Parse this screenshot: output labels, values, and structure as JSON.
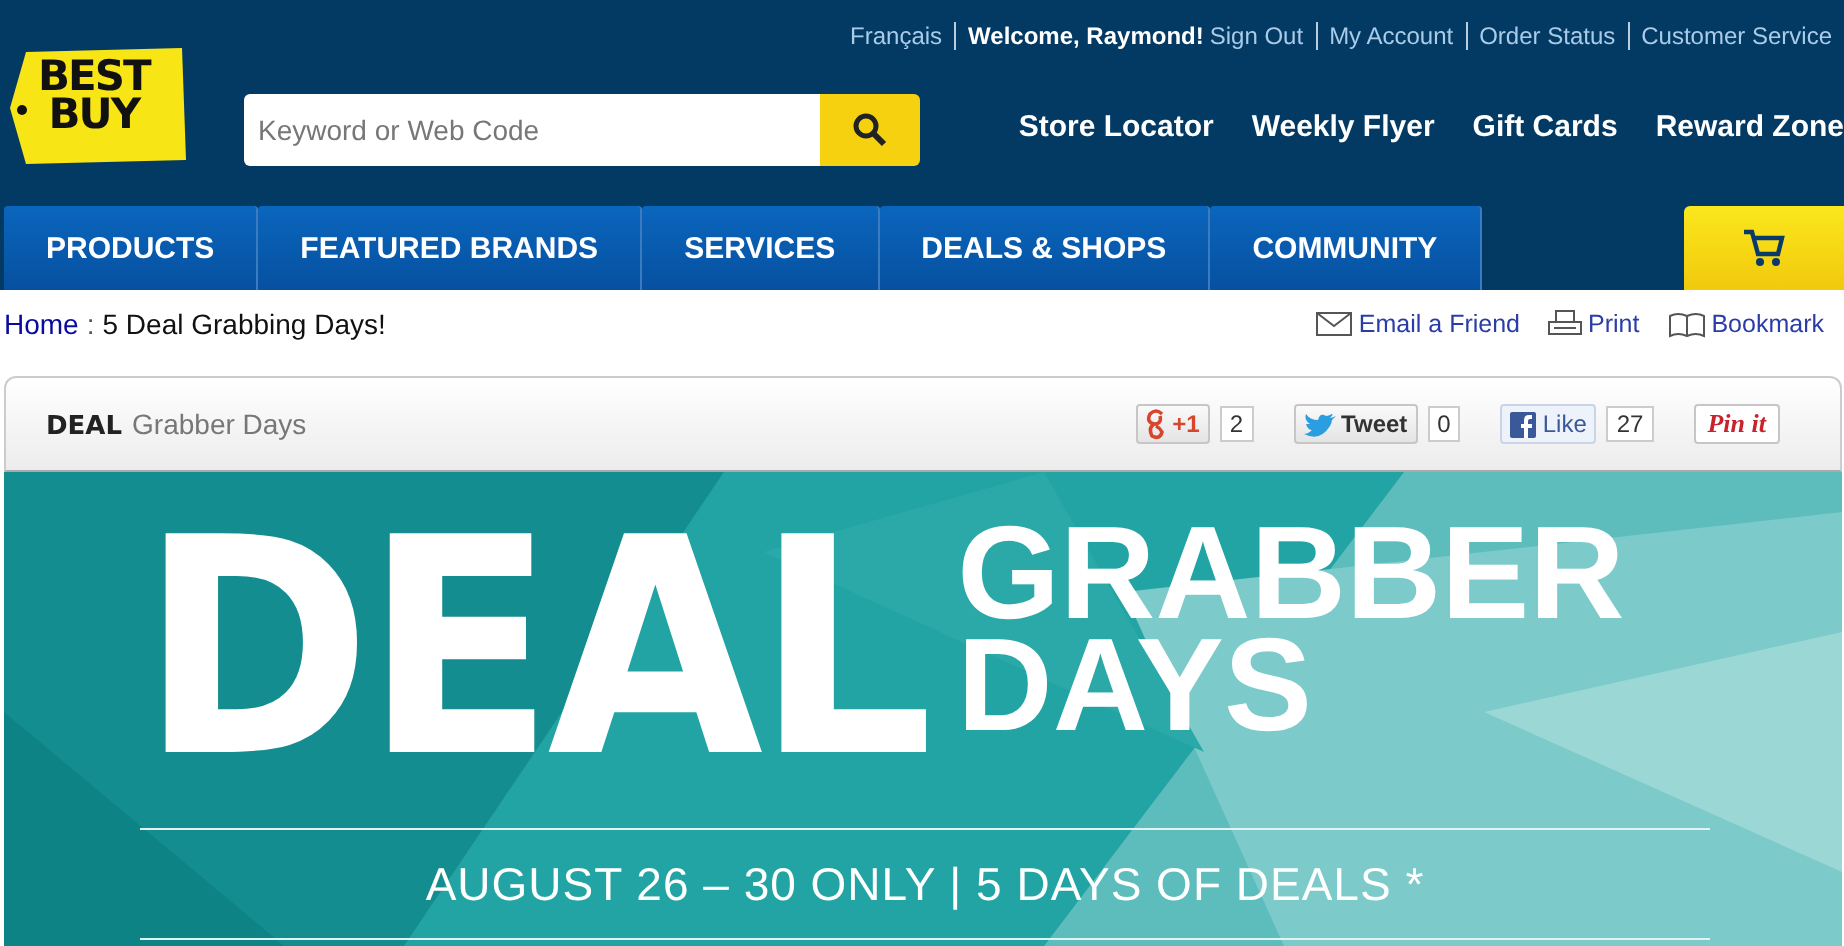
{
  "logo": {
    "lines": [
      "BEST",
      "BUY"
    ]
  },
  "utility_links": [
    {
      "label": "Français",
      "kind": "link"
    },
    {
      "label": "Welcome, Raymond!",
      "kind": "text"
    },
    {
      "label": "Sign Out",
      "kind": "link"
    },
    {
      "label": "My Account",
      "kind": "link"
    },
    {
      "label": "Order Status",
      "kind": "link"
    },
    {
      "label": "Customer Service",
      "kind": "link"
    }
  ],
  "search": {
    "placeholder": "Keyword or Web Code"
  },
  "main_links": [
    "Store Locator",
    "Weekly Flyer",
    "Gift Cards",
    "Reward Zone"
  ],
  "nav": [
    "PRODUCTS",
    "FEATURED BRANDS",
    "SERVICES",
    "DEALS & SHOPS",
    "COMMUNITY"
  ],
  "breadcrumb": {
    "home": "Home",
    "separator": ":",
    "current": "5 Deal Grabbing Days!"
  },
  "page_tools": [
    {
      "label": "Email a Friend",
      "kind": "email"
    },
    {
      "label": "Print",
      "kind": "print"
    },
    {
      "label": "Bookmark",
      "kind": "bookmark"
    }
  ],
  "card": {
    "title_bold": "DEAL",
    "title": "Grabber Days",
    "social": [
      {
        "kind": "gplus",
        "label": "+1",
        "count": "2"
      },
      {
        "kind": "tweet",
        "label": "Tweet",
        "count": "0"
      },
      {
        "kind": "like",
        "label": "Like",
        "count": "27"
      },
      {
        "kind": "pin",
        "label": "Pin it"
      }
    ]
  },
  "banner": {
    "big": "DEAL",
    "line1": "GRABBER",
    "line2": "DAYS",
    "subtitle": "AUGUST 26 – 30 ONLY | 5 DAYS OF DEALS *"
  }
}
